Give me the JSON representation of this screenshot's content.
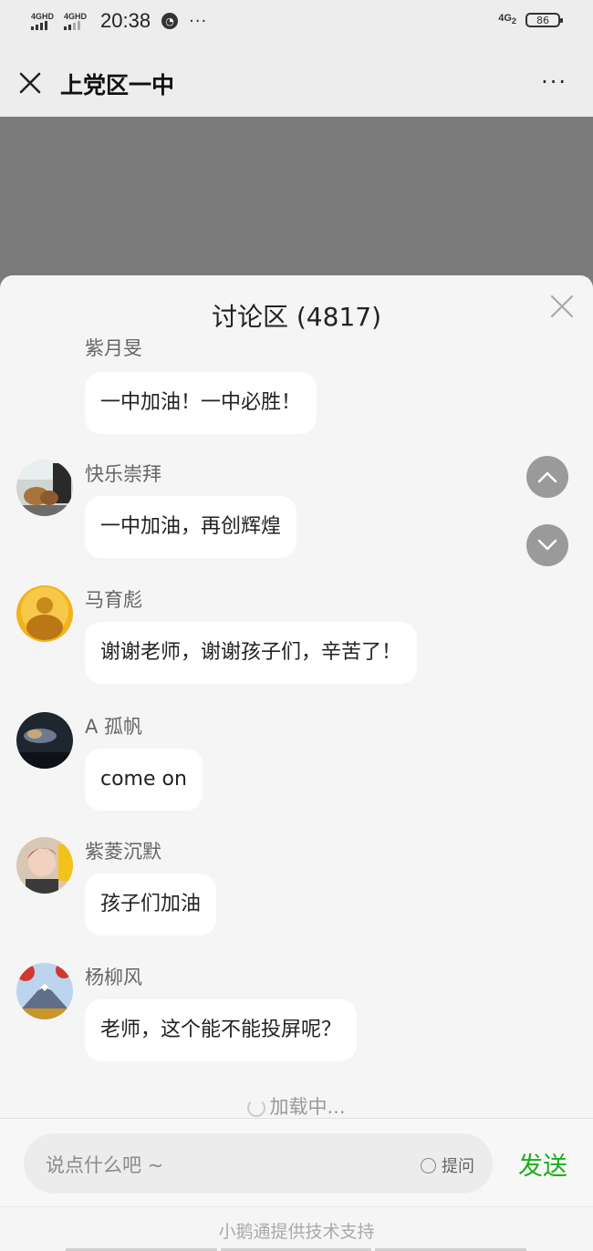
{
  "status_bar": {
    "sim1": "4GHD",
    "sim2": "4GHD",
    "time": "20:38",
    "icon_more": "···",
    "network": "4G",
    "network_sub": "2",
    "battery": "86"
  },
  "header": {
    "title": "上党区一中",
    "more": "···"
  },
  "discussion": {
    "title": "讨论区 (4817)",
    "messages": [
      {
        "name": "紫月旻",
        "text": "一中加油！一中必胜！",
        "avatar": "none"
      },
      {
        "name": "快乐崇拜",
        "text": "一中加油，再创辉煌",
        "avatar": "animals-photo"
      },
      {
        "name": "马育彪",
        "text": "谢谢老师，谢谢孩子们，辛苦了！",
        "avatar": "golden-buddha"
      },
      {
        "name": "A 孤帆",
        "text": "come on",
        "avatar": "night-sky"
      },
      {
        "name": "紫菱沉默",
        "text": "孩子们加油",
        "avatar": "woman-portrait"
      },
      {
        "name": "杨柳风",
        "text": "老师，这个能不能投屏呢？",
        "avatar": "mount-fuji"
      }
    ],
    "loading": "加载中..."
  },
  "input": {
    "placeholder": "说点什么吧 ~",
    "ask_label": "提问",
    "send_label": "发送"
  },
  "footer": {
    "powered_by": "小鹅通提供技术支持"
  },
  "colors": {
    "send_green": "#1aad19",
    "overlay_gray": "#7b7b7b",
    "sheet_bg": "#f5f5f5"
  }
}
